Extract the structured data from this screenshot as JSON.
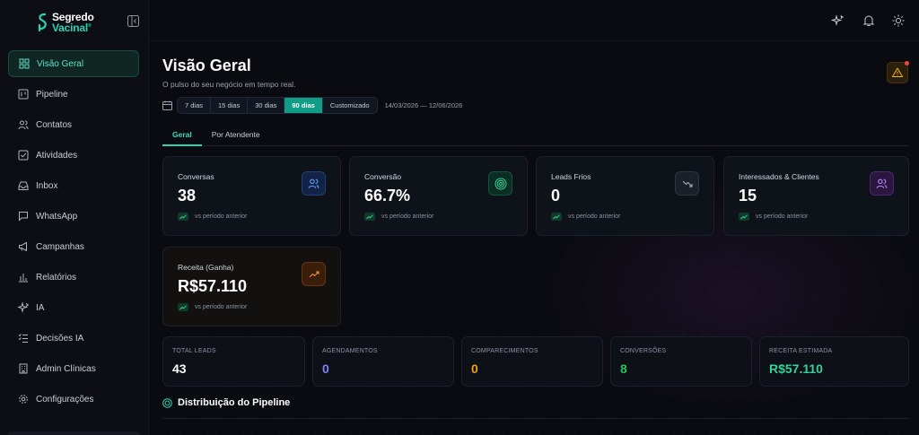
{
  "brand": {
    "line1": "Segredo",
    "line2": "Vacinal",
    "mark": "®"
  },
  "sidebar": {
    "items": [
      {
        "label": "Visão Geral",
        "icon": "dashboard-icon",
        "active": true
      },
      {
        "label": "Pipeline",
        "icon": "pipeline-icon"
      },
      {
        "label": "Contatos",
        "icon": "users-icon"
      },
      {
        "label": "Atividades",
        "icon": "checklist-icon"
      },
      {
        "label": "Inbox",
        "icon": "inbox-icon"
      },
      {
        "label": "WhatsApp",
        "icon": "chat-icon"
      },
      {
        "label": "Campanhas",
        "icon": "megaphone-icon"
      },
      {
        "label": "Relatórios",
        "icon": "bar-chart-icon"
      },
      {
        "label": "IA",
        "icon": "sparkles-icon"
      },
      {
        "label": "Decisões IA",
        "icon": "list-check-icon"
      },
      {
        "label": "Admin Clínicas",
        "icon": "building-icon"
      },
      {
        "label": "Configurações",
        "icon": "gear-icon"
      }
    ]
  },
  "header": {
    "title": "Visão Geral",
    "subtitle": "O pulso do seu negócio em tempo real."
  },
  "range": {
    "options": [
      "7 dias",
      "15 dias",
      "30 dias",
      "90 dias",
      "Customizado"
    ],
    "selected": "90 dias",
    "dates": "14/03/2026 — 12/06/2026"
  },
  "tabs": [
    {
      "label": "Geral",
      "active": true
    },
    {
      "label": "Por Atendente"
    }
  ],
  "cards": [
    {
      "label": "Conversas",
      "value": "38",
      "trend": "vs período anterior",
      "icon": "users-icon",
      "color": "#3b82f6"
    },
    {
      "label": "Conversão",
      "value": "66.7%",
      "trend": "vs período anterior",
      "icon": "target-icon",
      "color": "#10b981"
    },
    {
      "label": "Leads Frios",
      "value": "0",
      "trend": "vs período anterior",
      "icon": "trend-down-icon",
      "color": "#9ca3af"
    },
    {
      "label": "Interessados & Clientes",
      "value": "15",
      "trend": "vs período anterior",
      "icon": "users-icon",
      "color": "#a855f7"
    },
    {
      "label": "Receita (Ganha)",
      "value": "R$57.110",
      "trend": "vs período anterior",
      "icon": "trend-up-icon",
      "color": "#f97316"
    }
  ],
  "stats": [
    {
      "label": "TOTAL LEADS",
      "value": "43",
      "color": "#ffffff"
    },
    {
      "label": "AGENDAMENTOS",
      "value": "0",
      "color": "#7c83f6"
    },
    {
      "label": "COMPARECIMENTOS",
      "value": "0",
      "color": "#f59e0b"
    },
    {
      "label": "CONVERSÕES",
      "value": "8",
      "color": "#22c55e"
    },
    {
      "label": "RECEITA ESTIMADA",
      "value": "R$57.110",
      "color": "#34d399"
    }
  ],
  "section": {
    "title": "Distribuição do Pipeline"
  },
  "colors": {
    "accent": "#2bd4b4",
    "background": "#0a0b10"
  }
}
